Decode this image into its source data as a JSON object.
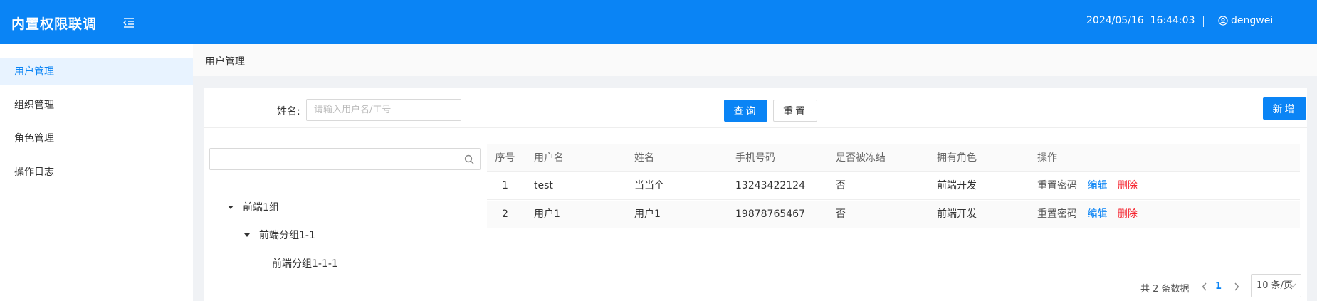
{
  "header": {
    "title": "内置权限联调",
    "date": "2024/05/16",
    "time": "16:44:03",
    "username": "dengwei"
  },
  "sidebar": {
    "items": [
      {
        "label": "用户管理",
        "active": true
      },
      {
        "label": "组织管理",
        "active": false
      },
      {
        "label": "角色管理",
        "active": false
      },
      {
        "label": "操作日志",
        "active": false
      }
    ]
  },
  "breadcrumb": "用户管理",
  "filter": {
    "name_label": "姓名:",
    "name_placeholder": "请输入用户名/工号",
    "query_label": "查询",
    "reset_label": "重置",
    "add_label": "新增"
  },
  "tree": {
    "search_value": "",
    "nodes": [
      {
        "label": "前端1组",
        "level": 0,
        "expanded": true
      },
      {
        "label": "前端分组1-1",
        "level": 1,
        "expanded": true
      },
      {
        "label": "前端分组1-1-1",
        "level": 2,
        "expanded": false
      }
    ]
  },
  "table": {
    "columns": [
      "序号",
      "用户名",
      "姓名",
      "手机号码",
      "是否被冻结",
      "拥有角色",
      "操作"
    ],
    "rows": [
      {
        "idx": "1",
        "username": "test",
        "name": "当当个",
        "phone": "13243422124",
        "frozen": "否",
        "role": "前端开发"
      },
      {
        "idx": "2",
        "username": "用户1",
        "name": "用户1",
        "phone": "19878765467",
        "frozen": "否",
        "role": "前端开发"
      }
    ],
    "actions": {
      "reset_pwd": "重置密码",
      "edit": "编辑",
      "delete": "删除"
    }
  },
  "pagination": {
    "total_text": "共 2 条数据",
    "current_page": "1",
    "page_size": "10 条/页"
  },
  "colors": {
    "primary": "#0a84f5",
    "danger": "#f5222d"
  },
  "icons": {
    "menu_toggle": "indent-list-icon",
    "user": "user-circle-icon",
    "search": "search-icon"
  }
}
